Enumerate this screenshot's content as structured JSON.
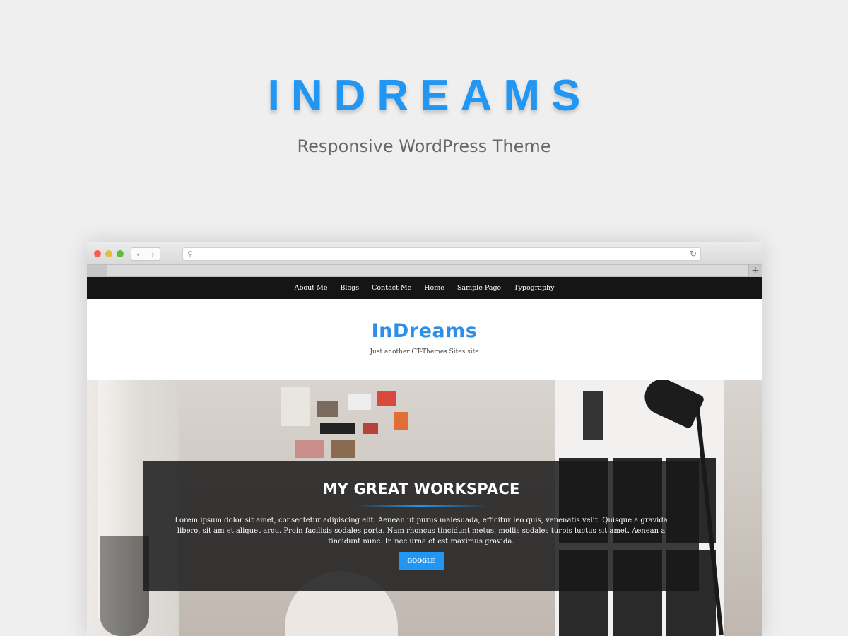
{
  "promo": {
    "title": "INDREAMS",
    "subtitle": "Responsive WordPress Theme",
    "accent_color": "#2196f3"
  },
  "browser": {
    "icons": {
      "back": "chevron-left-icon",
      "forward": "chevron-right-icon",
      "search": "search-icon",
      "reload": "reload-icon",
      "new_tab": "plus-icon"
    },
    "address_value": ""
  },
  "site": {
    "nav": [
      {
        "label": "About Me"
      },
      {
        "label": "Blogs"
      },
      {
        "label": "Contact Me"
      },
      {
        "label": "Home"
      },
      {
        "label": "Sample Page"
      },
      {
        "label": "Typography"
      }
    ],
    "title": "InDreams",
    "tagline": "Just another GT-Themes Sites site",
    "hero": {
      "heading": "MY GREAT WORKSPACE",
      "text": "Lorem ipsum dolor sit amet, consectetur adipiscing elit. Aenean ut purus malesuada, efficitur leo quis, venenatis velit. Quisque a gravida libero, sit am et aliquet arcu. Proin facilisis sodales porta. Nam rhoncus tincidunt metus, mollis sodales turpis luctus sit amet. Aenean a tincidunt nunc. In nec urna et est maximus gravida.",
      "button_label": "GOOGLE"
    }
  }
}
